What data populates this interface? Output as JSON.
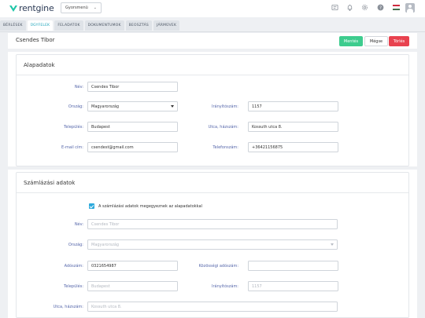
{
  "brand": {
    "name": "rentgine"
  },
  "header": {
    "quick_menu": "Gyorsmenü",
    "flag_colors": [
      "#cd2a3e",
      "#ffffff",
      "#436f4d"
    ]
  },
  "tabs": [
    {
      "label": "BÉRLÉSEK",
      "active": false
    },
    {
      "label": "ÜGYFELEK",
      "active": true
    },
    {
      "label": "FELADATOK",
      "active": false
    },
    {
      "label": "DOKUMENTUMOK",
      "active": false
    },
    {
      "label": "BEOSZTÁS",
      "active": false
    },
    {
      "label": "JÁRMŰVEK",
      "active": false
    }
  ],
  "page": {
    "title": "Csendes Tibor",
    "save_label": "Mentés",
    "cancel_label": "Mégse",
    "delete_label": "Törlés"
  },
  "basic": {
    "title": "Alapadatok",
    "name_label": "Név:",
    "name_value": "Csendes Tibor",
    "country_label": "Ország:",
    "country_value": "Magyarország",
    "zip_label": "Irányítószám:",
    "zip_value": "1157",
    "city_label": "Település:",
    "city_value": "Budapest",
    "street_label": "Utca, házszám:",
    "street_value": "Kossuth utca 8.",
    "email_label": "E-mail cím:",
    "email_value": "csendest@gmail.com",
    "phone_label": "Telefonszám:",
    "phone_value": "+36421156875"
  },
  "billing": {
    "title": "Számlázási adatok",
    "same_label": "A számlázási adatok megegyeznek az alapadatokkal",
    "same_checked": true,
    "name_label": "Név:",
    "name_value": "Csendes Tibor",
    "country_label": "Ország:",
    "country_value": "Magyarország",
    "tax_label": "Adószám:",
    "tax_value": "0321654987",
    "eu_tax_label": "Közösségi adószám:",
    "eu_tax_value": "",
    "city_label": "Település:",
    "city_value": "Budapest",
    "zip_label": "Irányítószám:",
    "zip_value": "1157",
    "street_label": "Utca, házszám:",
    "street_value": "Kossuth utca 8."
  }
}
